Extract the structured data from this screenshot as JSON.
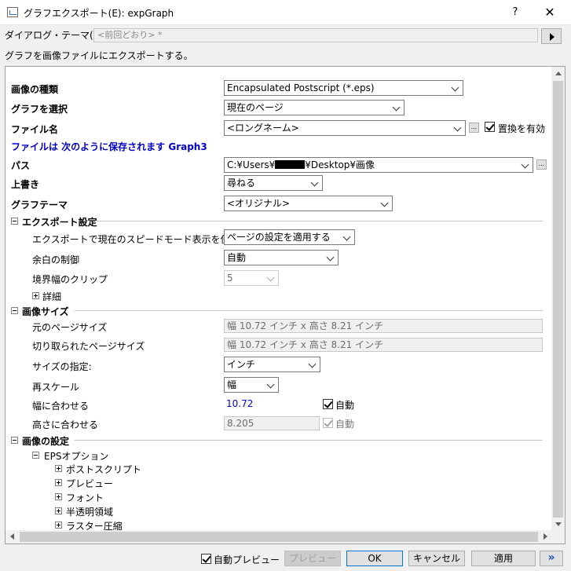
{
  "window": {
    "title": "グラフエクスポート(E): expGraph",
    "help_label": "?",
    "close_label": "✕"
  },
  "theme": {
    "label": "ダイアログ・テーマ(H)",
    "value": "<前回どおり> *"
  },
  "description": "グラフを画像ファイルにエクスポートする。",
  "settings": {
    "image_type": {
      "label": "画像の種類",
      "value": "Encapsulated Postscript (*.eps)"
    },
    "select_graph": {
      "label": "グラフを選択",
      "value": "現在のページ"
    },
    "file_name": {
      "label": "ファイル名",
      "value": "<ロングネーム>",
      "browse_label": "...",
      "replace_label": "置換を有効"
    },
    "save_notice": "ファイルは 次のように保存されます Graph3",
    "path": {
      "label": "パス",
      "value_prefix": "C:¥Users¥",
      "value_suffix": "¥Desktop¥画像",
      "browse_label": "..."
    },
    "overwrite": {
      "label": "上書き",
      "value": "尋ねる"
    },
    "graph_theme": {
      "label": "グラフテーマ",
      "value": "<オリジナル>"
    }
  },
  "export_settings": {
    "header": "エクスポート設定",
    "speed_mode": {
      "label": "エクスポートで現在のスピードモード表示を使う",
      "value": "ページの設定を適用する"
    },
    "margin": {
      "label": "余白の制御",
      "value": "自動"
    },
    "clip": {
      "label": "境界幅のクリップ",
      "value": "5"
    },
    "details_label": "詳細"
  },
  "image_size": {
    "header": "画像サイズ",
    "original": {
      "label": "元のページサイズ",
      "value": "幅 10.72 インチ x 高さ 8.21 インチ"
    },
    "cropped": {
      "label": "切り取られたページサイズ",
      "value": "幅 10.72 インチ x 高さ 8.21 インチ"
    },
    "unit": {
      "label": "サイズの指定:",
      "value": "インチ"
    },
    "rescale": {
      "label": "再スケール",
      "value": "幅"
    },
    "fit_width": {
      "label": "幅に合わせる",
      "value": "10.72",
      "auto_label": "自動"
    },
    "fit_height": {
      "label": "高さに合わせる",
      "value": "8.205",
      "auto_label": "自動"
    }
  },
  "image_settings": {
    "header": "画像の設定",
    "eps_options": "EPSオプション",
    "children": [
      "ポストスクリプト",
      "プレビュー",
      "フォント",
      "半透明領域",
      "ラスター圧縮"
    ]
  },
  "footer": {
    "auto_preview_label": "自動プレビュー",
    "preview_label": "プレビュー",
    "ok_label": "OK",
    "cancel_label": "キャンセル",
    "apply_label": "適用",
    "more_label": "»"
  }
}
